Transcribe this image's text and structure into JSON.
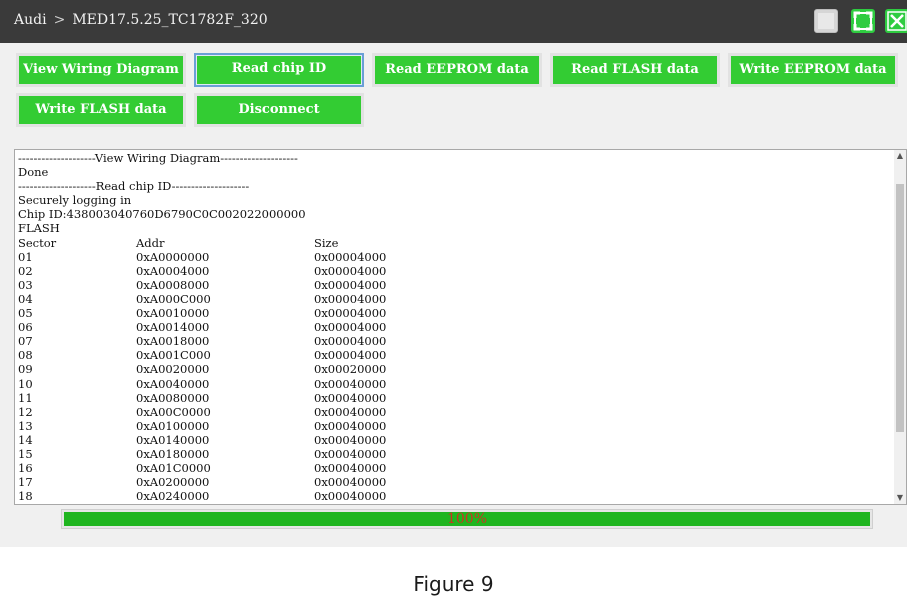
{
  "titlebar": {
    "brand": "Audi",
    "separator": ">",
    "model": "MED17.5.25_TC1782F_320",
    "controls": [
      "minimize",
      "maximize",
      "close"
    ]
  },
  "colors": {
    "button_green": "#33cc33",
    "titlebar_bg": "#3a3a3a",
    "progress_green": "#1fb51f",
    "progress_text": "#cc3322"
  },
  "buttons": {
    "view_wiring": "View Wiring Diagram",
    "read_chip_id": "Read chip ID",
    "read_eeprom": "Read EEPROM data",
    "read_flash": "Read FLASH data",
    "write_eeprom": "Write EEPROM data",
    "write_flash": "Write FLASH data",
    "disconnect": "Disconnect"
  },
  "log": {
    "lines": [
      "--------------------View Wiring Diagram--------------------",
      "Done",
      "--------------------Read chip ID--------------------",
      "Securely logging in",
      "Chip ID:438003040760D6790C0C002022000000",
      "FLASH"
    ],
    "columns": [
      "Sector",
      "Addr",
      "Size"
    ],
    "rows": [
      [
        "01",
        "0xA0000000",
        "0x00004000"
      ],
      [
        "02",
        "0xA0004000",
        "0x00004000"
      ],
      [
        "03",
        "0xA0008000",
        "0x00004000"
      ],
      [
        "04",
        "0xA000C000",
        "0x00004000"
      ],
      [
        "05",
        "0xA0010000",
        "0x00004000"
      ],
      [
        "06",
        "0xA0014000",
        "0x00004000"
      ],
      [
        "07",
        "0xA0018000",
        "0x00004000"
      ],
      [
        "08",
        "0xA001C000",
        "0x00004000"
      ],
      [
        "09",
        "0xA0020000",
        "0x00020000"
      ],
      [
        "10",
        "0xA0040000",
        "0x00040000"
      ],
      [
        "11",
        "0xA0080000",
        "0x00040000"
      ],
      [
        "12",
        "0xA00C0000",
        "0x00040000"
      ],
      [
        "13",
        "0xA0100000",
        "0x00040000"
      ],
      [
        "14",
        "0xA0140000",
        "0x00040000"
      ],
      [
        "15",
        "0xA0180000",
        "0x00040000"
      ],
      [
        "16",
        "0xA01C0000",
        "0x00040000"
      ],
      [
        "17",
        "0xA0200000",
        "0x00040000"
      ],
      [
        "18",
        "0xA0240000",
        "0x00040000"
      ]
    ]
  },
  "progress": {
    "label": "100%",
    "value": 1.0
  },
  "caption": "Figure 9"
}
